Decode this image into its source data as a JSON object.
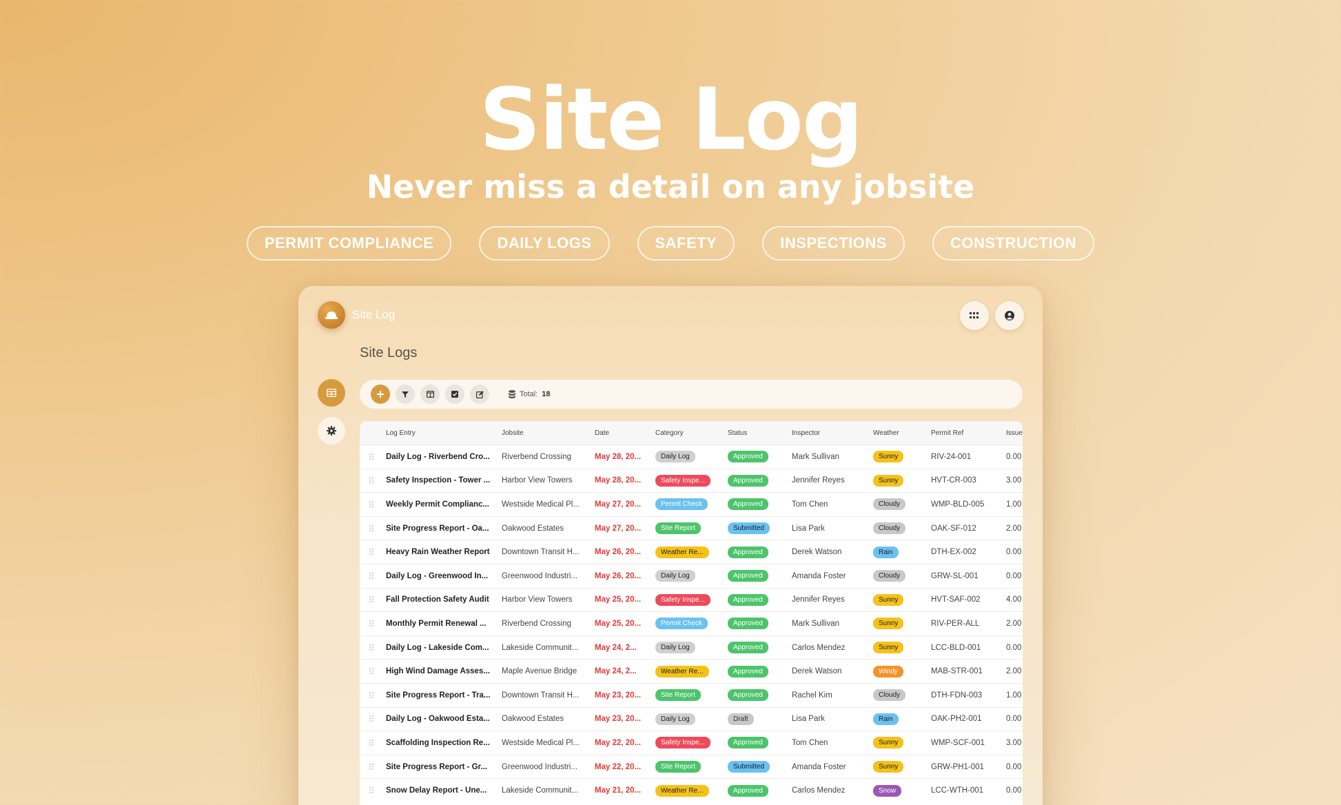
{
  "hero": {
    "title": "Site Log",
    "subtitle": "Never miss a detail on any jobsite",
    "tags": [
      "PERMIT COMPLIANCE",
      "DAILY LOGS",
      "SAFETY",
      "INSPECTIONS",
      "CONSTRUCTION"
    ]
  },
  "app": {
    "name": "Site Log",
    "page_title": "Site Logs",
    "toolbar": {
      "total_label": "Total:",
      "total_value": "18"
    },
    "columns": [
      "Log Entry",
      "Jobsite",
      "Date",
      "Category",
      "Status",
      "Inspector",
      "Weather",
      "Permit Ref",
      "Issue"
    ],
    "rows": [
      {
        "entry": "Daily Log - Riverbend Cro...",
        "site": "Riverbend Crossing",
        "date": "May 28, 20...",
        "category": "Daily Log",
        "status": "Approved",
        "inspector": "Mark Sullivan",
        "weather": "Sunny",
        "permit": "RIV-24-001",
        "issue": "0.00"
      },
      {
        "entry": "Safety Inspection - Tower ...",
        "site": "Harbor View Towers",
        "date": "May 28, 20...",
        "category": "Safety Inspe...",
        "status": "Approved",
        "inspector": "Jennifer Reyes",
        "weather": "Sunny",
        "permit": "HVT-CR-003",
        "issue": "3.00"
      },
      {
        "entry": "Weekly Permit Complianc...",
        "site": "Westside Medical Pl...",
        "date": "May 27, 20...",
        "category": "Permit Check",
        "status": "Approved",
        "inspector": "Tom Chen",
        "weather": "Cloudy",
        "permit": "WMP-BLD-005",
        "issue": "1.00"
      },
      {
        "entry": "Site Progress Report - Oa...",
        "site": "Oakwood Estates",
        "date": "May 27, 20...",
        "category": "Site Report",
        "status": "Submitted",
        "inspector": "Lisa Park",
        "weather": "Cloudy",
        "permit": "OAK-SF-012",
        "issue": "2.00"
      },
      {
        "entry": "Heavy Rain Weather Report",
        "site": "Downtown Transit H...",
        "date": "May 26, 20...",
        "category": "Weather Re...",
        "status": "Approved",
        "inspector": "Derek Watson",
        "weather": "Rain",
        "permit": "DTH-EX-002",
        "issue": "0.00"
      },
      {
        "entry": "Daily Log - Greenwood In...",
        "site": "Greenwood Industri...",
        "date": "May 26, 20...",
        "category": "Daily Log",
        "status": "Approved",
        "inspector": "Amanda Foster",
        "weather": "Cloudy",
        "permit": "GRW-SL-001",
        "issue": "0.00"
      },
      {
        "entry": "Fall Protection Safety Audit",
        "site": "Harbor View Towers",
        "date": "May 25, 20...",
        "category": "Safety Inspe...",
        "status": "Approved",
        "inspector": "Jennifer Reyes",
        "weather": "Sunny",
        "permit": "HVT-SAF-002",
        "issue": "4.00"
      },
      {
        "entry": "Monthly Permit Renewal ...",
        "site": "Riverbend Crossing",
        "date": "May 25, 20...",
        "category": "Permit Check",
        "status": "Approved",
        "inspector": "Mark Sullivan",
        "weather": "Sunny",
        "permit": "RIV-PER-ALL",
        "issue": "2.00"
      },
      {
        "entry": "Daily Log - Lakeside Com...",
        "site": "Lakeside Communit...",
        "date": "May 24, 2...",
        "category": "Daily Log",
        "status": "Approved",
        "inspector": "Carlos Mendez",
        "weather": "Sunny",
        "permit": "LCC-BLD-001",
        "issue": "0.00"
      },
      {
        "entry": "High Wind Damage Asses...",
        "site": "Maple Avenue Bridge",
        "date": "May 24, 2...",
        "category": "Weather Re...",
        "status": "Approved",
        "inspector": "Derek Watson",
        "weather": "Windy",
        "permit": "MAB-STR-001",
        "issue": "2.00"
      },
      {
        "entry": "Site Progress Report - Tra...",
        "site": "Downtown Transit H...",
        "date": "May 23, 20...",
        "category": "Site Report",
        "status": "Approved",
        "inspector": "Rachel Kim",
        "weather": "Cloudy",
        "permit": "DTH-FDN-003",
        "issue": "1.00"
      },
      {
        "entry": "Daily Log - Oakwood Esta...",
        "site": "Oakwood Estates",
        "date": "May 23, 20...",
        "category": "Daily Log",
        "status": "Draft",
        "inspector": "Lisa Park",
        "weather": "Rain",
        "permit": "OAK-PH2-001",
        "issue": "0.00"
      },
      {
        "entry": "Scaffolding Inspection Re...",
        "site": "Westside Medical Pl...",
        "date": "May 22, 20...",
        "category": "Safety Inspe...",
        "status": "Approved",
        "inspector": "Tom Chen",
        "weather": "Sunny",
        "permit": "WMP-SCF-001",
        "issue": "3.00"
      },
      {
        "entry": "Site Progress Report - Gr...",
        "site": "Greenwood Industri...",
        "date": "May 22, 20...",
        "category": "Site Report",
        "status": "Submitted",
        "inspector": "Amanda Foster",
        "weather": "Sunny",
        "permit": "GRW-PH1-001",
        "issue": "0.00"
      },
      {
        "entry": "Snow Delay Report - Une...",
        "site": "Lakeside Communit...",
        "date": "May 21, 20...",
        "category": "Weather Re...",
        "status": "Approved",
        "inspector": "Carlos Mendez",
        "weather": "Snow",
        "permit": "LCC-WTH-001",
        "issue": "0.00"
      }
    ]
  },
  "colors": {
    "accent": "#d79a3e",
    "category": {
      "Daily Log": "#cfcfcf",
      "Safety Inspe...": "#ef4a5b",
      "Permit Check": "#6bc1ef",
      "Site Report": "#4cc46b",
      "Weather Re...": "#f4c21a"
    },
    "status": {
      "Approved": "#4cc46b",
      "Submitted": "#6bc1ef",
      "Draft": "#c8c8c8"
    },
    "weather": {
      "Sunny": "#f4c21a",
      "Cloudy": "#c8c8c8",
      "Rain": "#6bc1ef",
      "Windy": "#f2932b",
      "Snow": "#9b59b6"
    }
  },
  "icons": {
    "logo": "hard-hat-icon",
    "apps": "grid-icon",
    "account": "user-circle-icon",
    "table_view": "table-icon",
    "settings": "gear-icon",
    "toolbar": [
      "plus-icon",
      "filter-icon",
      "columns-icon",
      "checkbox-icon",
      "edit-icon",
      "database-icon"
    ]
  }
}
